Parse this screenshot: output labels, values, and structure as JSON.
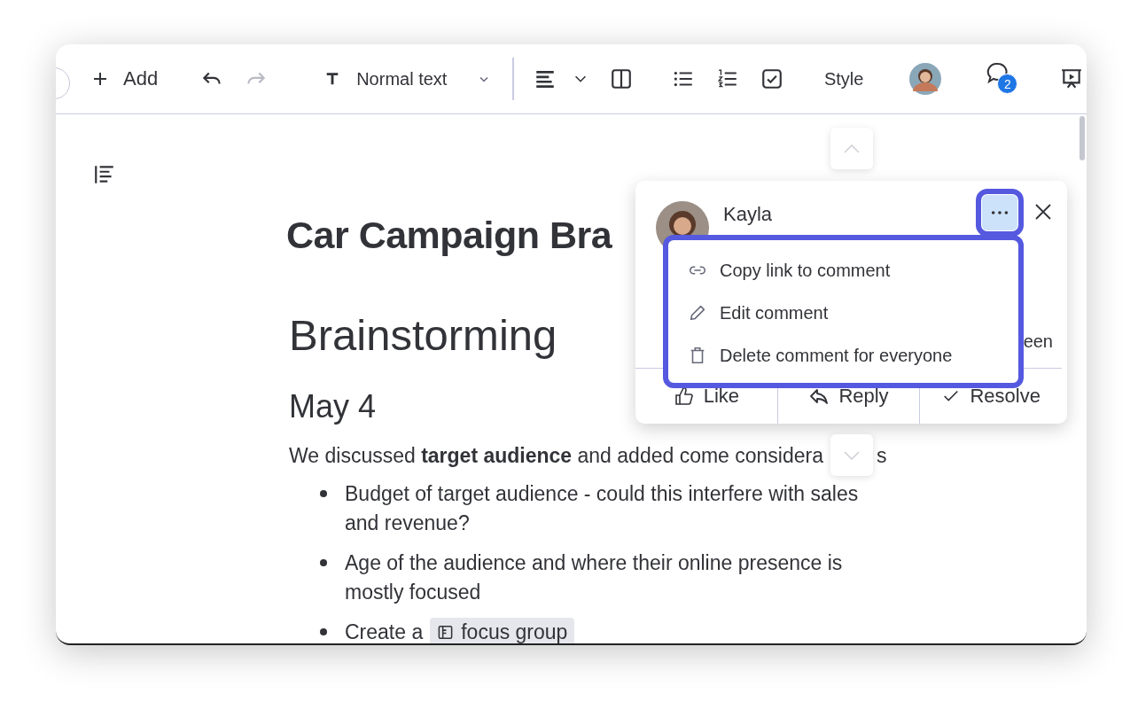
{
  "toolbar": {
    "add_label": "Add",
    "undo": {
      "disabled": false
    },
    "redo": {
      "disabled": true
    },
    "text_style": "Normal text",
    "style_label": "Style",
    "comments_badge": "2"
  },
  "document": {
    "title": "Car Campaign Bra",
    "heading": "Brainstorming",
    "subheading": "May 4",
    "paragraph": "We discussed **target audience** and added come considera",
    "paragraph_end": "s",
    "bullets": [
      {
        "kind": "text",
        "text": "Budget of target audience - could this interfere with sales and revenue?"
      },
      {
        "kind": "text",
        "text": "Age of the audience and where their online presence is mostly focused"
      },
      {
        "kind": "chip",
        "text": "Create a",
        "chip": "focus group"
      }
    ]
  },
  "comment": {
    "author": "Kayla",
    "fragment": "een",
    "actions": [
      {
        "kind": "like",
        "label": "Like"
      },
      {
        "kind": "reply",
        "label": "Reply"
      },
      {
        "kind": "resolve",
        "label": "Resolve"
      }
    ]
  },
  "menu": {
    "items": [
      {
        "kind": "link",
        "label": "Copy link to comment"
      },
      {
        "kind": "edit",
        "label": "Edit comment"
      },
      {
        "kind": "delete",
        "label": "Delete comment for everyone"
      }
    ]
  }
}
